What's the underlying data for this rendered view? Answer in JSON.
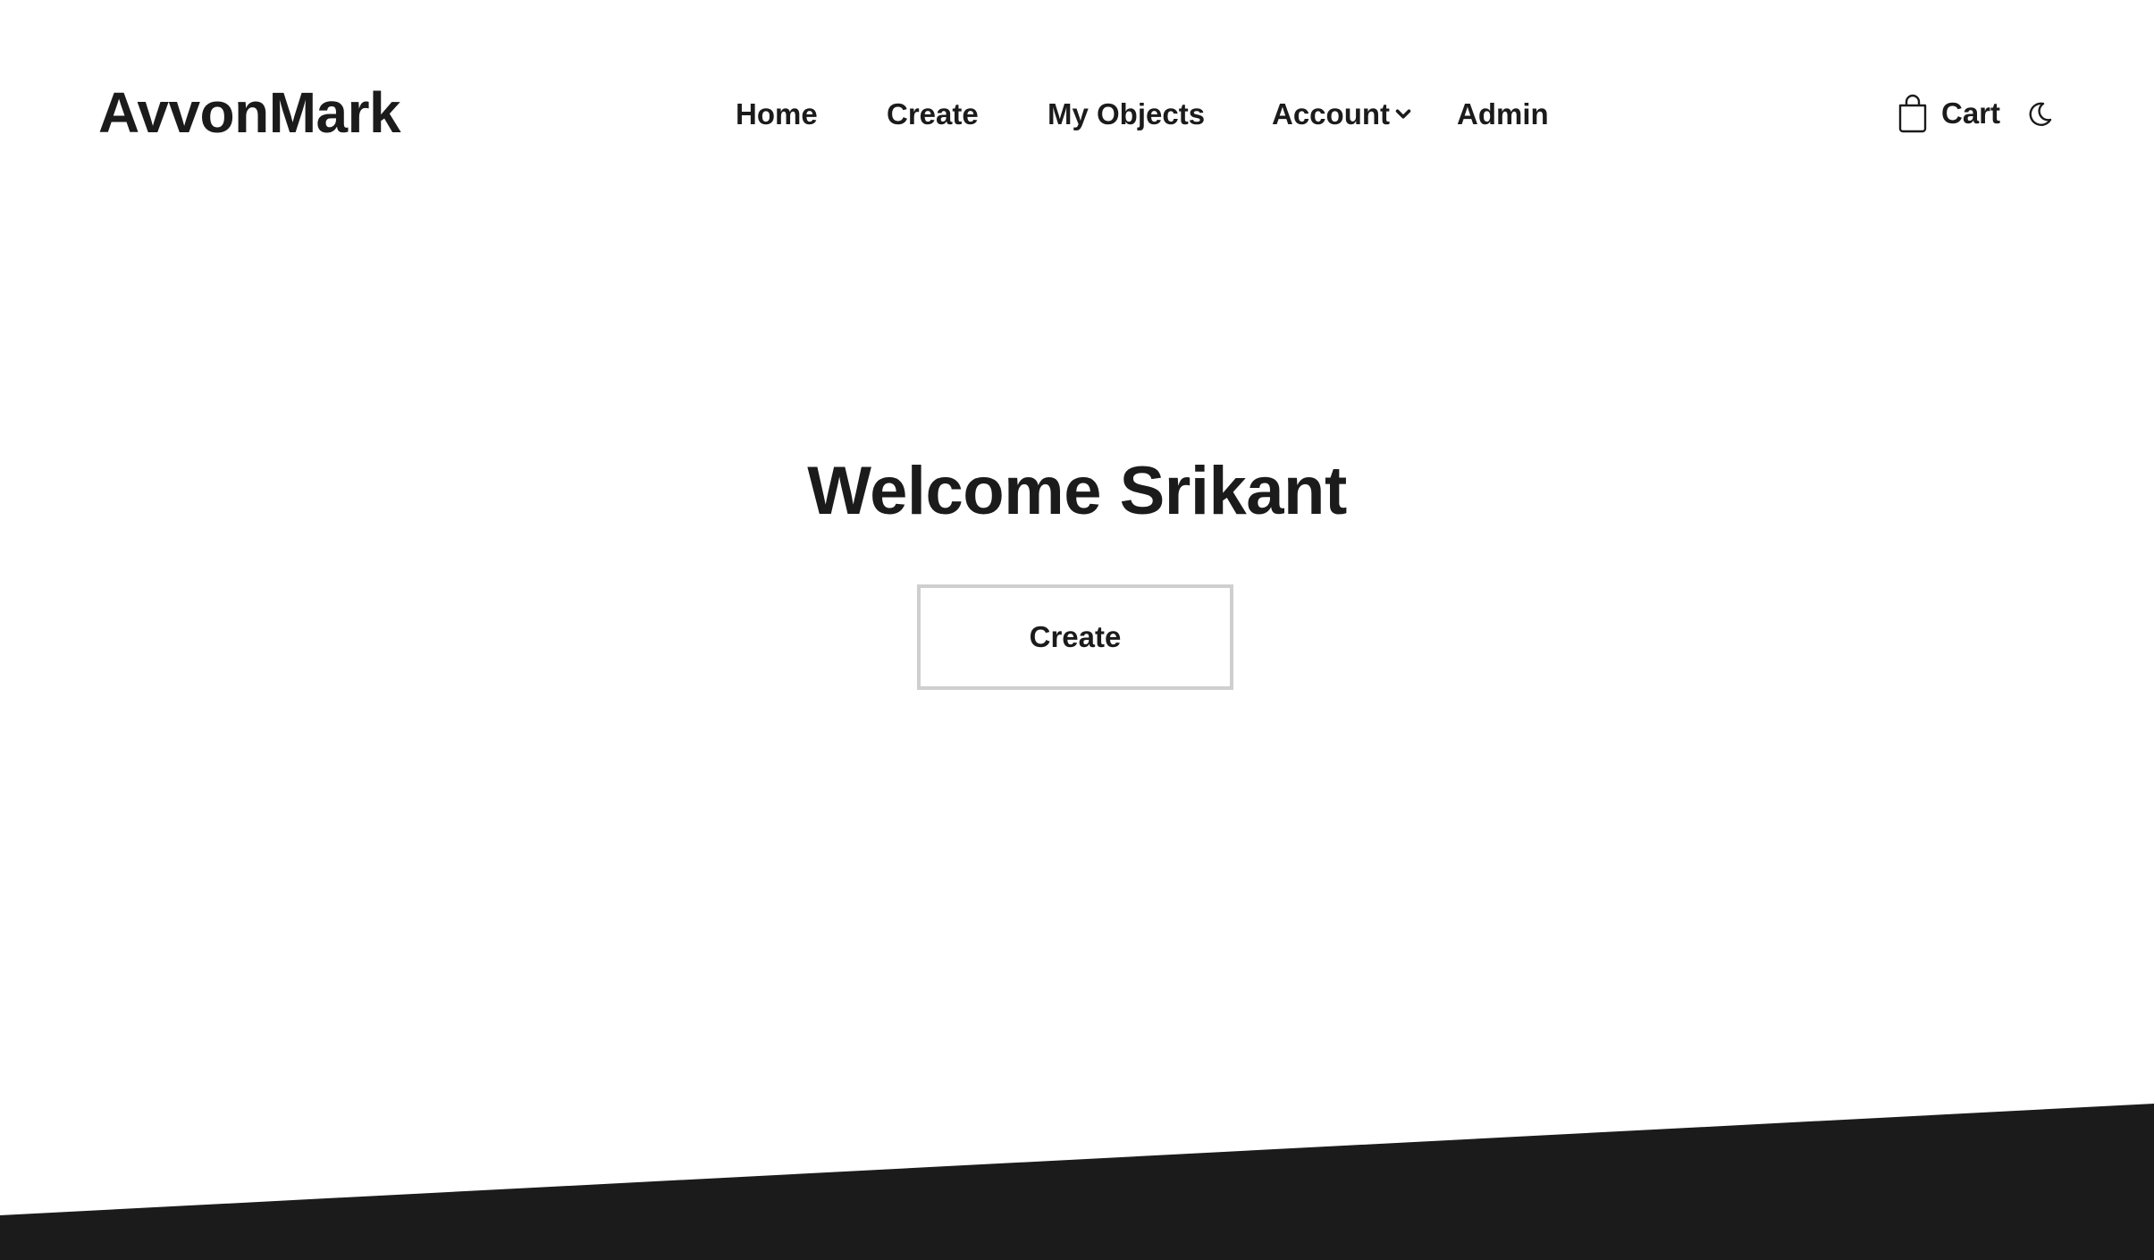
{
  "header": {
    "brand": "AvvonMark",
    "nav": {
      "home": "Home",
      "create": "Create",
      "my_objects": "My Objects",
      "account": "Account",
      "admin": "Admin"
    },
    "cart_label": "Cart",
    "icons": {
      "cart": "shopping-bag-icon",
      "account_dropdown": "chevron-down-icon",
      "theme": "moon-icon"
    }
  },
  "hero": {
    "title": "Welcome Srikant",
    "button_label": "Create"
  },
  "colors": {
    "text": "#1b1b1b",
    "background": "#ffffff",
    "button_border": "#cfcfcf",
    "footer_band": "#1b1b1b"
  }
}
